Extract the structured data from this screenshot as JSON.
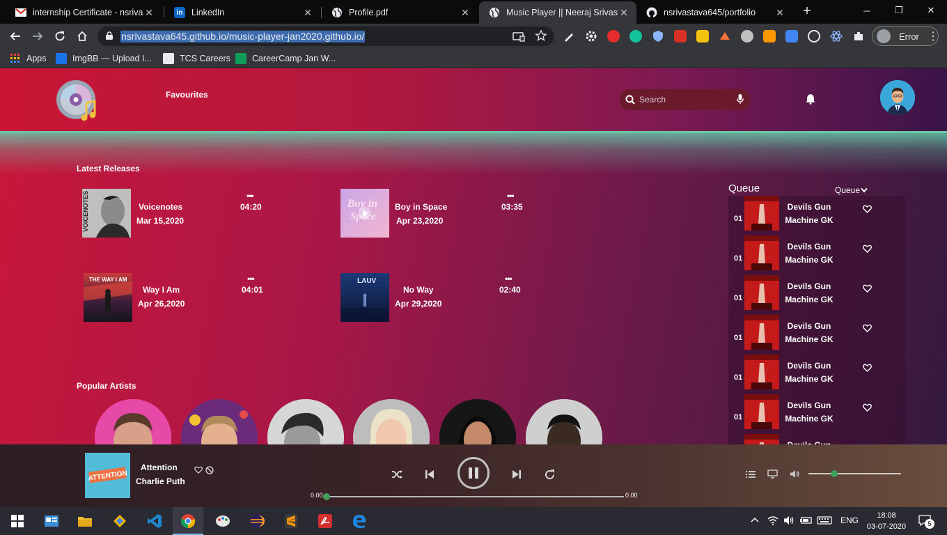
{
  "browser": {
    "tabs": [
      {
        "title": "internship Certificate - nsrivast",
        "icon": "gmail-icon"
      },
      {
        "title": "LinkedIn",
        "icon": "linkedin-icon"
      },
      {
        "title": "Profile.pdf",
        "icon": "globe-icon"
      },
      {
        "title": "Music Player || Neeraj Srivastav",
        "icon": "globe-icon",
        "active": true
      },
      {
        "title": "nsrivastava645/portfolio",
        "icon": "github-icon"
      }
    ],
    "url": "nsrivastava645.github.io/music-player-jan2020.github.io/",
    "profile_status": "Error",
    "bookmarks": [
      "Apps",
      "ImgBB — Upload I...",
      "TCS Careers",
      "CareerCamp Jan W..."
    ]
  },
  "header": {
    "nav_favourites": "Favourites",
    "search_placeholder": "Search"
  },
  "latest_releases": {
    "title": "Latest Releases",
    "items": [
      {
        "name": "Voicenotes",
        "date": "Mar 15,2020",
        "duration": "04:20",
        "menu": "•••"
      },
      {
        "name": "Boy in Space",
        "date": "Apr 23,2020",
        "duration": "03:35",
        "menu": "•••"
      },
      {
        "name": "Way I Am",
        "date": "Apr 26,2020",
        "duration": "04:01",
        "menu": "•••"
      },
      {
        "name": "No Way",
        "date": "Apr 29,2020",
        "duration": "02:40",
        "menu": "•••"
      }
    ]
  },
  "popular_artists": {
    "title": "Popular Artists"
  },
  "queue": {
    "title": "Queue",
    "dropdown_label": "Queue",
    "items": [
      {
        "num": "01",
        "line1": "Devils Gun",
        "line2": "Machine GK"
      },
      {
        "num": "01",
        "line1": "Devils Gun",
        "line2": "Machine GK"
      },
      {
        "num": "01",
        "line1": "Devils Gun",
        "line2": "Machine GK"
      },
      {
        "num": "01",
        "line1": "Devils Gun",
        "line2": "Machine GK"
      },
      {
        "num": "01",
        "line1": "Devils Gun",
        "line2": "Machine GK"
      },
      {
        "num": "01",
        "line1": "Devils Gun",
        "line2": "Machine GK"
      },
      {
        "num": "",
        "line1": "Devils Gun",
        "line2": ""
      }
    ]
  },
  "player": {
    "track_title": "Attention",
    "track_artist": "Charlie Puth",
    "cover_text": "ATTENTION",
    "time_current": "0.00",
    "time_total": "0.00",
    "progress_fraction": 0.0,
    "volume_fraction": 0.28
  },
  "taskbar": {
    "language": "ENG",
    "time": "18:08",
    "date": "03-07-2020",
    "notifications": "5"
  },
  "colors": {
    "accent_green": "#3fa05a",
    "header_red": "#c91634",
    "teal": "#6fc3a5"
  }
}
